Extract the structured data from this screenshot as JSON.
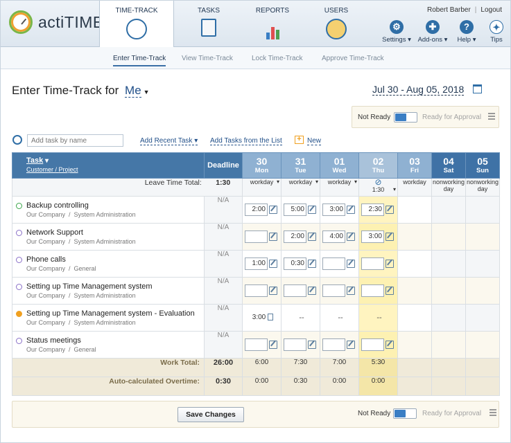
{
  "app": {
    "name": "actiTIME"
  },
  "tabs": [
    {
      "label": "TIME-TRACK"
    },
    {
      "label": "TASKS"
    },
    {
      "label": "REPORTS"
    },
    {
      "label": "USERS"
    }
  ],
  "user": {
    "name": "Robert Barber",
    "logout": "Logout"
  },
  "tools": [
    {
      "label": "Settings",
      "icon": "gear-icon"
    },
    {
      "label": "Add-ons",
      "icon": "puzzle-icon"
    },
    {
      "label": "Help",
      "icon": "help-icon"
    },
    {
      "label": "Tips",
      "icon": "bulb-icon"
    }
  ],
  "subnav": [
    "Enter Time-Track",
    "View Time-Track",
    "Lock Time-Track",
    "Approve Time-Track"
  ],
  "heading": {
    "prefix": "Enter Time-Track for",
    "who": "Me",
    "range": "Jul 30 - Aug 05, 2018"
  },
  "status": {
    "not_ready": "Not Ready",
    "ready": "Ready for Approval"
  },
  "toolbar": {
    "search_placeholder": "Add task by name",
    "recent": "Add Recent Task",
    "from_list": "Add Tasks from the List",
    "new": "New"
  },
  "columns": {
    "task": "Task",
    "customer": "Customer",
    "project": "Project",
    "deadline": "Deadline"
  },
  "days": [
    {
      "num": "30",
      "name": "Mon"
    },
    {
      "num": "31",
      "name": "Tue"
    },
    {
      "num": "01",
      "name": "Wed"
    },
    {
      "num": "02",
      "name": "Thu"
    },
    {
      "num": "03",
      "name": "Fri"
    },
    {
      "num": "04",
      "name": "Sat"
    },
    {
      "num": "05",
      "name": "Sun"
    }
  ],
  "leave": {
    "label": "Leave Time Total:",
    "total": "1:30",
    "types": [
      "workday",
      "workday",
      "workday",
      "1:30",
      "workday",
      "nonworking day",
      "nonworking day"
    ]
  },
  "rows": [
    {
      "name": "Backup controlling",
      "customer": "Our Company",
      "project": "System Administration",
      "deadline": "N/A",
      "values": [
        "2:00",
        "5:00",
        "3:00",
        "2:30"
      ]
    },
    {
      "name": "Network Support",
      "customer": "Our Company",
      "project": "System Administration",
      "deadline": "N/A",
      "values": [
        "",
        "2:00",
        "4:00",
        "3:00"
      ]
    },
    {
      "name": "Phone calls",
      "customer": "Our Company",
      "project": "General",
      "deadline": "N/A",
      "values": [
        "1:00",
        "0:30",
        "",
        ""
      ]
    },
    {
      "name": "Setting up Time Management system",
      "customer": "Our Company",
      "project": "System Administration",
      "deadline": "N/A",
      "values": [
        "",
        "",
        "",
        ""
      ]
    },
    {
      "name": "Setting up Time Management system - Evaluation",
      "customer": "Our Company",
      "project": "System Administration",
      "deadline": "N/A",
      "values": [
        "3:00",
        "--",
        "--",
        "--"
      ]
    },
    {
      "name": "Status meetings",
      "customer": "Our Company",
      "project": "General",
      "deadline": "N/A",
      "values": [
        "",
        "",
        "",
        ""
      ]
    }
  ],
  "totals": {
    "work_label": "Work Total:",
    "work": "26:00",
    "work_days": [
      "6:00",
      "7:30",
      "7:00",
      "5:30"
    ],
    "ot_label": "Auto-calculated Overtime:",
    "ot": "0:30",
    "ot_days": [
      "0:00",
      "0:30",
      "0:00",
      "0:00"
    ]
  },
  "footer": {
    "save": "Save Changes"
  }
}
